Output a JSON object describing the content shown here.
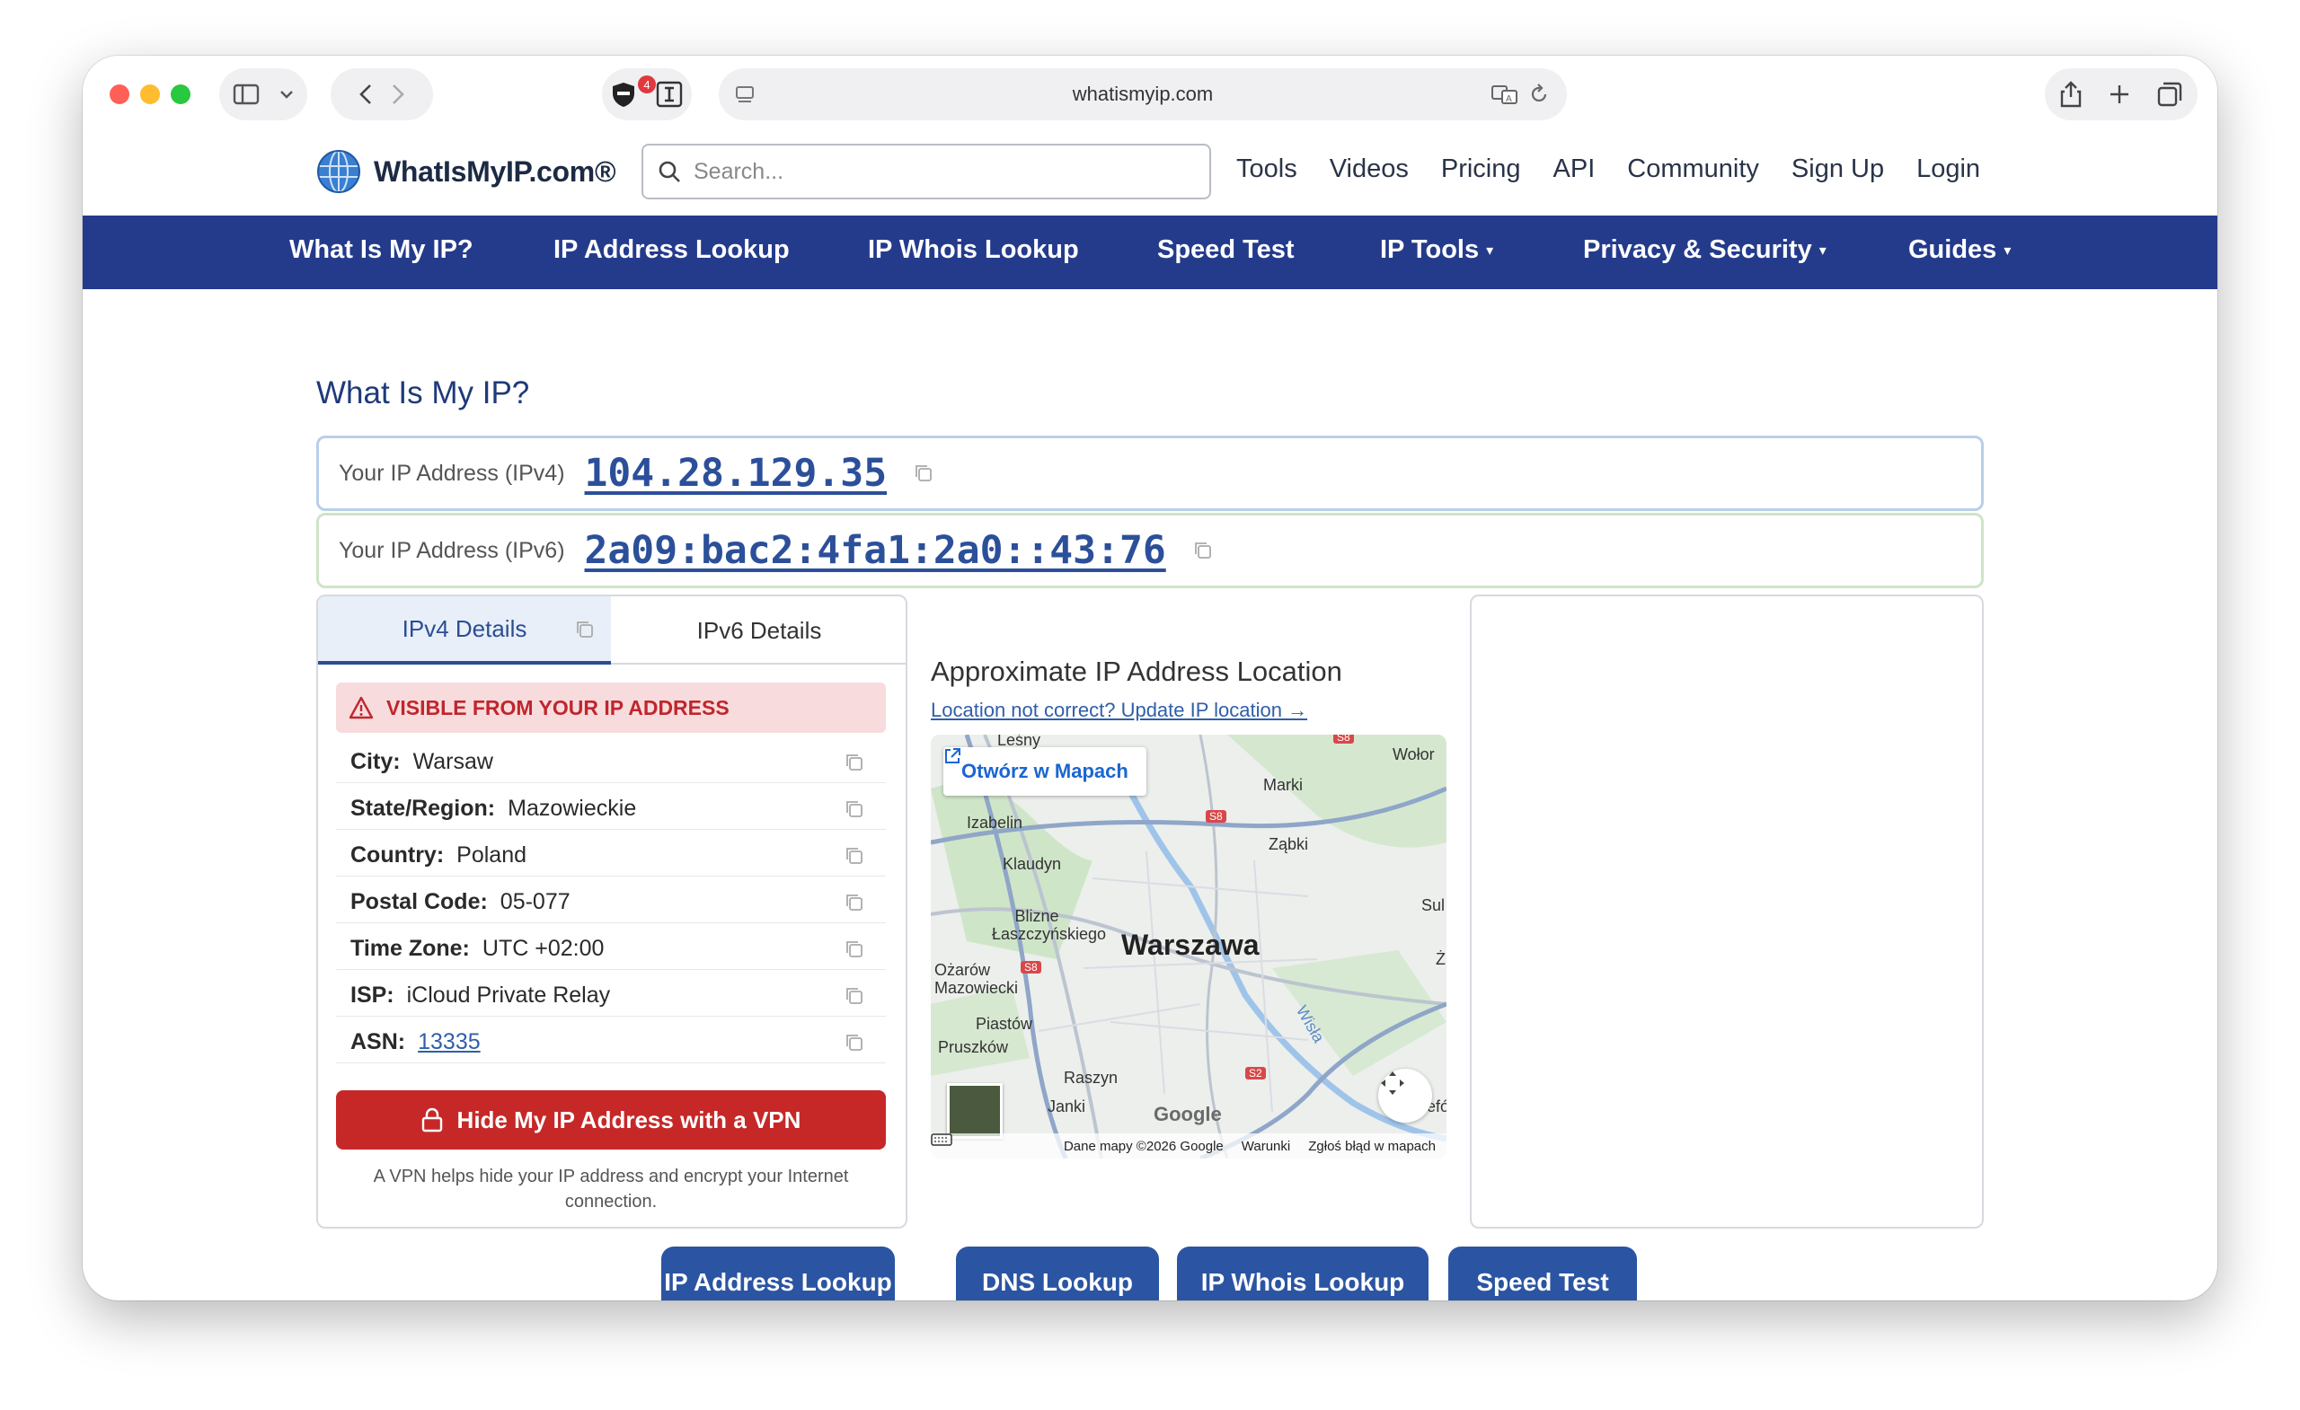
{
  "browser": {
    "url": "whatismyip.com",
    "shield_badge": "4"
  },
  "site": {
    "logo_text": "WhatIsMyIP.com®",
    "search_placeholder": "Search...",
    "top_links": [
      "Tools",
      "Videos",
      "Pricing",
      "API",
      "Community",
      "Sign Up",
      "Login"
    ],
    "nav": [
      {
        "label": "What Is My IP?",
        "dropdown": false
      },
      {
        "label": "IP Address Lookup",
        "dropdown": false
      },
      {
        "label": "IP Whois Lookup",
        "dropdown": false
      },
      {
        "label": "Speed Test",
        "dropdown": false
      },
      {
        "label": "IP Tools",
        "dropdown": true
      },
      {
        "label": "Privacy & Security",
        "dropdown": true
      },
      {
        "label": "Guides",
        "dropdown": true
      }
    ],
    "nav_caret": "▾"
  },
  "main": {
    "title": "What Is My IP?",
    "ipv4": {
      "label": "Your IP Address (IPv4)",
      "value": "104.28.129.35"
    },
    "ipv6": {
      "label": "Your IP Address (IPv6)",
      "value": "2a09:bac2:4fa1:2a0::43:76"
    },
    "details": {
      "tabs": [
        "IPv4 Details",
        "IPv6 Details"
      ],
      "active_tab": "IPv4 Details",
      "alert": "VISIBLE FROM YOUR IP ADDRESS",
      "rows": [
        {
          "label": "City:",
          "value": "Warsaw"
        },
        {
          "label": "State/Region:",
          "value": "Mazowieckie"
        },
        {
          "label": "Country:",
          "value": "Poland"
        },
        {
          "label": "Postal Code:",
          "value": "05-077"
        },
        {
          "label": "Time Zone:",
          "value": "UTC +02:00"
        },
        {
          "label": "ISP:",
          "value": "iCloud Private Relay"
        },
        {
          "label": "ASN:",
          "value": "13335"
        }
      ],
      "vpn_button": "Hide My IP Address with a VPN",
      "vpn_note": "A VPN helps hide your IP address and encrypt your Internet connection."
    },
    "map": {
      "title": "Approximate IP Address Location",
      "update_link": "Location not correct? Update IP location →",
      "open_in_maps": "Otwórz w Mapach",
      "city": "Warszawa",
      "places": [
        "Leśny",
        "Wołor",
        "Marki",
        "Izabelin",
        "Ząbki",
        "Klaudyn",
        "Sul",
        "Blizne Łaszczyńskiego",
        "Ożarów Mazowiecki",
        "Piastów",
        "Pruszków",
        "Raszyn",
        "Janki",
        "Wisła",
        "Ż",
        "Józefów"
      ],
      "road_badges": [
        "S8",
        "S8",
        "S8",
        "S2"
      ],
      "google": "Google",
      "footer": [
        "Dane mapy ©2026 Google",
        "Warunki",
        "Zgłoś błąd w mapach"
      ]
    },
    "bottom_buttons": [
      "IP Address Lookup",
      "DNS Lookup",
      "IP Whois Lookup",
      "Speed Test"
    ]
  },
  "colors": {
    "nav_blue": "#243b8c",
    "accent_blue": "#2c4f9a",
    "vpn_red": "#c62828",
    "alert_bg": "#f8dcdd"
  }
}
